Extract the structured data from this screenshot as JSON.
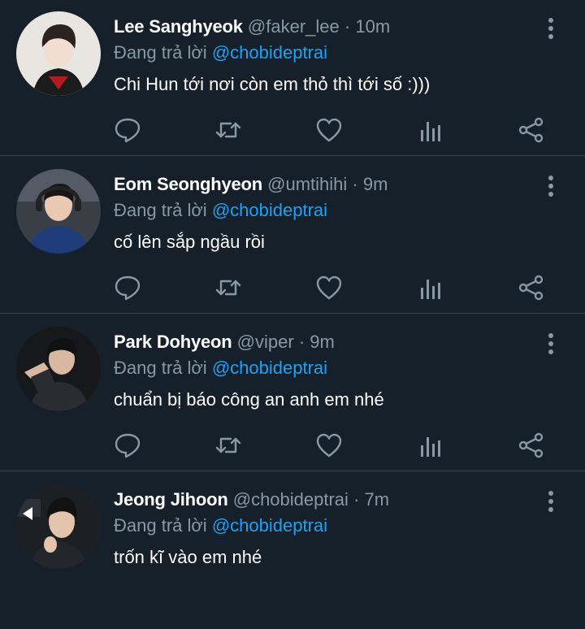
{
  "tweets": [
    {
      "name": "Lee Sanghyeok",
      "handle": "@faker_lee",
      "separator": "·",
      "time": "10m",
      "reply_prefix": "Đang trả lời",
      "reply_to": "@chobideptrai",
      "text": "Chi Hun tới nơi còn em thỏ thì tới số :)))"
    },
    {
      "name": "Eom Seonghyeon",
      "handle": "@umtihihi",
      "separator": "·",
      "time": "9m",
      "reply_prefix": "Đang trả lời",
      "reply_to": "@chobideptrai",
      "text": "cố lên sắp ngầu rồi"
    },
    {
      "name": "Park Dohyeon",
      "handle": "@viper",
      "separator": "·",
      "time": "9m",
      "reply_prefix": "Đang trả lời",
      "reply_to": "@chobideptrai",
      "text": "chuẩn bị báo công an anh em nhé"
    },
    {
      "name": "Jeong Jihoon",
      "handle": "@chobideptrai",
      "separator": "·",
      "time": "7m",
      "reply_prefix": "Đang trả lời",
      "reply_to": "@chobideptrai",
      "text": "trốn kĩ vào em nhé"
    }
  ],
  "icons": [
    "reply-icon",
    "retweet-icon",
    "like-icon",
    "analytics-icon",
    "share-icon",
    "more-options-icon"
  ],
  "colors": {
    "background": "#15202b",
    "divider": "#38444d",
    "secondary_text": "#8899a6",
    "accent": "#1da1f2",
    "primary_text": "#ffffff"
  }
}
